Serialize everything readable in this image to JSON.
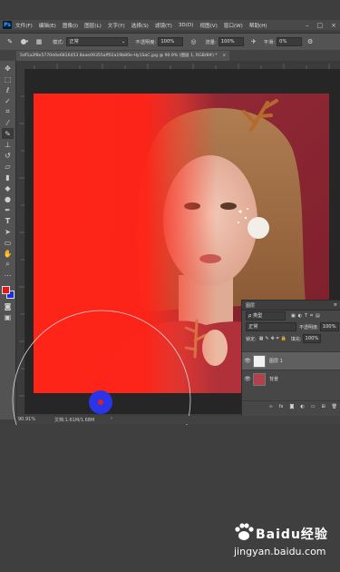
{
  "menubar": {
    "app_logo": "Ps",
    "items": [
      "文件(F)",
      "编辑(E)",
      "图像(I)",
      "图层(L)",
      "文字(Y)",
      "选择(S)",
      "滤镜(T)",
      "3D(D)",
      "视图(V)",
      "窗口(W)",
      "帮助(H)"
    ]
  },
  "options_bar": {
    "mode_label": "模式:",
    "mode_value": "正常",
    "opacity_label": "不透明度:",
    "opacity_value": "100%",
    "flow_label": "流量:",
    "flow_value": "100%",
    "smoothing_label": "平滑:",
    "smoothing_value": "0%"
  },
  "document_tab": {
    "title": "5df1a2f8e5770d4e6816453 8aae09355aff02a19b80e-Hy1SaC.jpg @ 90.9% (图层 1, RGB/8#) *"
  },
  "status_bar": {
    "zoom": "90.91%",
    "doc_info": "文档:1.61M/1.68M"
  },
  "layers_panel": {
    "title": "图层",
    "filter_kind": "ρ 类型",
    "blend_mode": "正常",
    "opacity_label": "不透明度:",
    "opacity_value": "100%",
    "lock_label": "锁定:",
    "fill_label": "填充:",
    "fill_value": "100%",
    "layers": [
      {
        "name": "图层 1",
        "selected": true
      },
      {
        "name": "背景",
        "selected": false
      }
    ],
    "footer_icons": [
      "link-icon",
      "fx-icon",
      "mask-icon",
      "adjustment-icon",
      "group-icon",
      "new-layer-icon",
      "trash-icon"
    ]
  },
  "colors": {
    "foreground": "#e01818",
    "background": "#1a2ee0",
    "canvas_overlay": "#ff2a1e"
  },
  "watermark": {
    "brand": "Baidu经验",
    "url": "jingyan.baidu.com"
  }
}
